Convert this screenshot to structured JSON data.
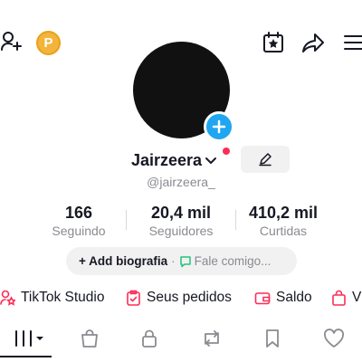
{
  "profile": {
    "username": "Jairzeera",
    "handle": "@jairzeera_"
  },
  "stats": [
    {
      "value": "166",
      "label": "Seguindo"
    },
    {
      "value": "20,4 mil",
      "label": "Seguidores"
    },
    {
      "value": "410,2 mil",
      "label": "Curtidas"
    }
  ],
  "bio": {
    "add_label": "+ Add biografia",
    "separator": "·",
    "message_label": "Fale comigo..."
  },
  "shortcuts": [
    {
      "label": "TikTok Studio",
      "icon": "studio-icon"
    },
    {
      "label": "Seus pedidos",
      "icon": "orders-icon"
    },
    {
      "label": "Saldo",
      "icon": "wallet-icon"
    },
    {
      "label": "Vi",
      "icon": "bag-icon"
    }
  ],
  "coin": {
    "label": "P"
  },
  "colors": {
    "accent_blue": "#20a6f0",
    "accent_red": "#fe2c55",
    "coin_gold": "#f2b43a",
    "text_primary": "#161823",
    "text_secondary": "#8a8b91"
  }
}
